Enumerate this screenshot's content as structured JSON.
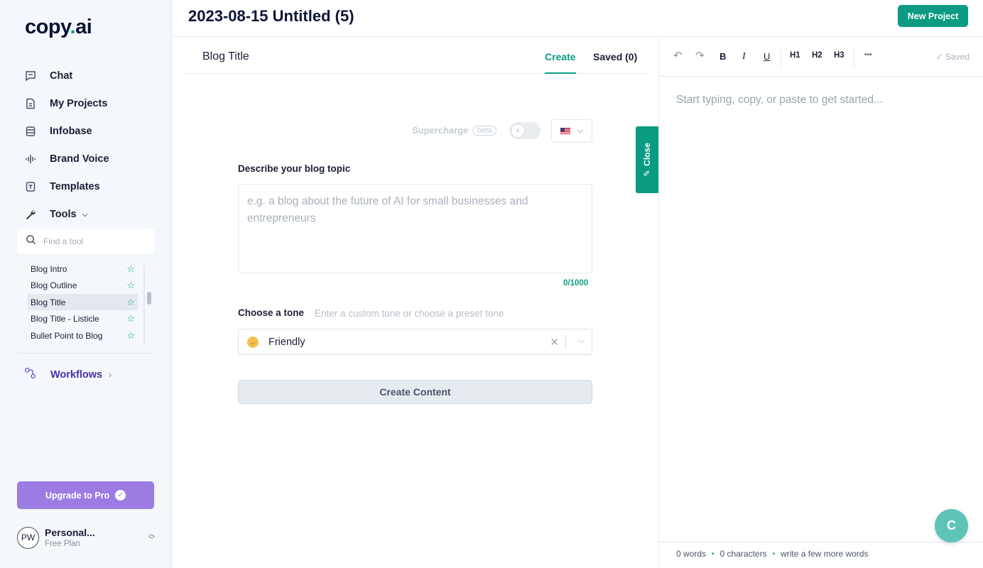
{
  "app": {
    "logo_text": "copy",
    "logo_dot": ".",
    "logo_suffix": "ai",
    "accent": "#0b9b83",
    "purple": "#9b7ce3"
  },
  "header": {
    "title": "2023-08-15 Untitled (5)",
    "new_project": "New Project"
  },
  "sidebar": {
    "nav": [
      {
        "label": "Chat",
        "icon": "chat-icon"
      },
      {
        "label": "My Projects",
        "icon": "document-icon"
      },
      {
        "label": "Infobase",
        "icon": "database-icon"
      },
      {
        "label": "Brand Voice",
        "icon": "soundwave-icon"
      },
      {
        "label": "Templates",
        "icon": "template-icon"
      },
      {
        "label": "Tools",
        "icon": "wrench-icon"
      }
    ],
    "search_placeholder": "Find a tool",
    "tools": [
      {
        "label": "Blog Intro",
        "active": false
      },
      {
        "label": "Blog Outline",
        "active": false
      },
      {
        "label": "Blog Title",
        "active": true
      },
      {
        "label": "Blog Title - Listicle",
        "active": false
      },
      {
        "label": "Bullet Point to Blog",
        "active": false
      }
    ],
    "workflows": "Workflows",
    "upgrade": "Upgrade to Pro",
    "account": {
      "initials": "PW",
      "name": "Personal...",
      "plan": "Free Plan"
    }
  },
  "main": {
    "tool_title": "Blog Title",
    "tab_create": "Create",
    "tab_saved": "Saved (0)",
    "supercharge": "Supercharge",
    "beta": "beta",
    "topic_label": "Describe your blog topic",
    "topic_placeholder": "e.g. a blog about the future of AI for small businesses and entrepreneurs",
    "counter": "0/1000",
    "tone_label": "Choose a tone",
    "tone_hint": "Enter a custom tone or choose a preset tone",
    "tone_value": "Friendly",
    "create_button": "Create Content",
    "close_tab": "Close"
  },
  "editor": {
    "toolbar": {
      "undo": "↶",
      "redo": "↷",
      "bold": "B",
      "italic": "I",
      "underline": "U",
      "h1": "H1",
      "h2": "H2",
      "h3": "H3",
      "more": "•••"
    },
    "saved_status": "Saved",
    "placeholder": "Start typing, copy, or paste to get started...",
    "stats": {
      "words": "0 words",
      "characters": "0 characters",
      "hint": "write a few more words"
    },
    "fab": "C"
  }
}
